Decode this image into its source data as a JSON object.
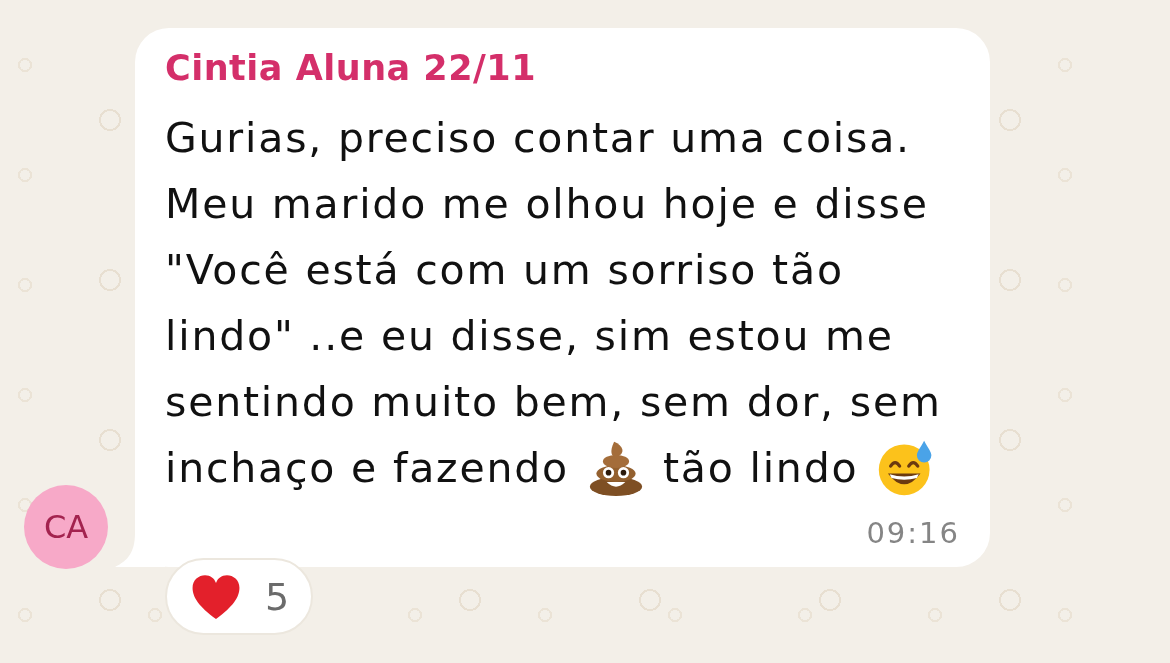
{
  "avatar": {
    "initials": "CA"
  },
  "message": {
    "sender": "Cintia Aluna 22/11",
    "rows": [
      [
        {
          "kind": "text",
          "text": "Gurias, preciso contar uma coisa.\nMeu marido me olhou hoje e disse\n\"Você está com um sorriso tão\nlindo\" ..e eu disse, sim estou me\nsentindo muito bem, sem dor, sem"
        }
      ],
      [
        {
          "kind": "text",
          "text": "inchaço e fazendo"
        },
        {
          "kind": "poop"
        },
        {
          "kind": "text",
          "text": "tão lindo"
        },
        {
          "kind": "grin_sweat"
        }
      ]
    ],
    "time": "09:16"
  },
  "reaction": {
    "count": "5"
  }
}
